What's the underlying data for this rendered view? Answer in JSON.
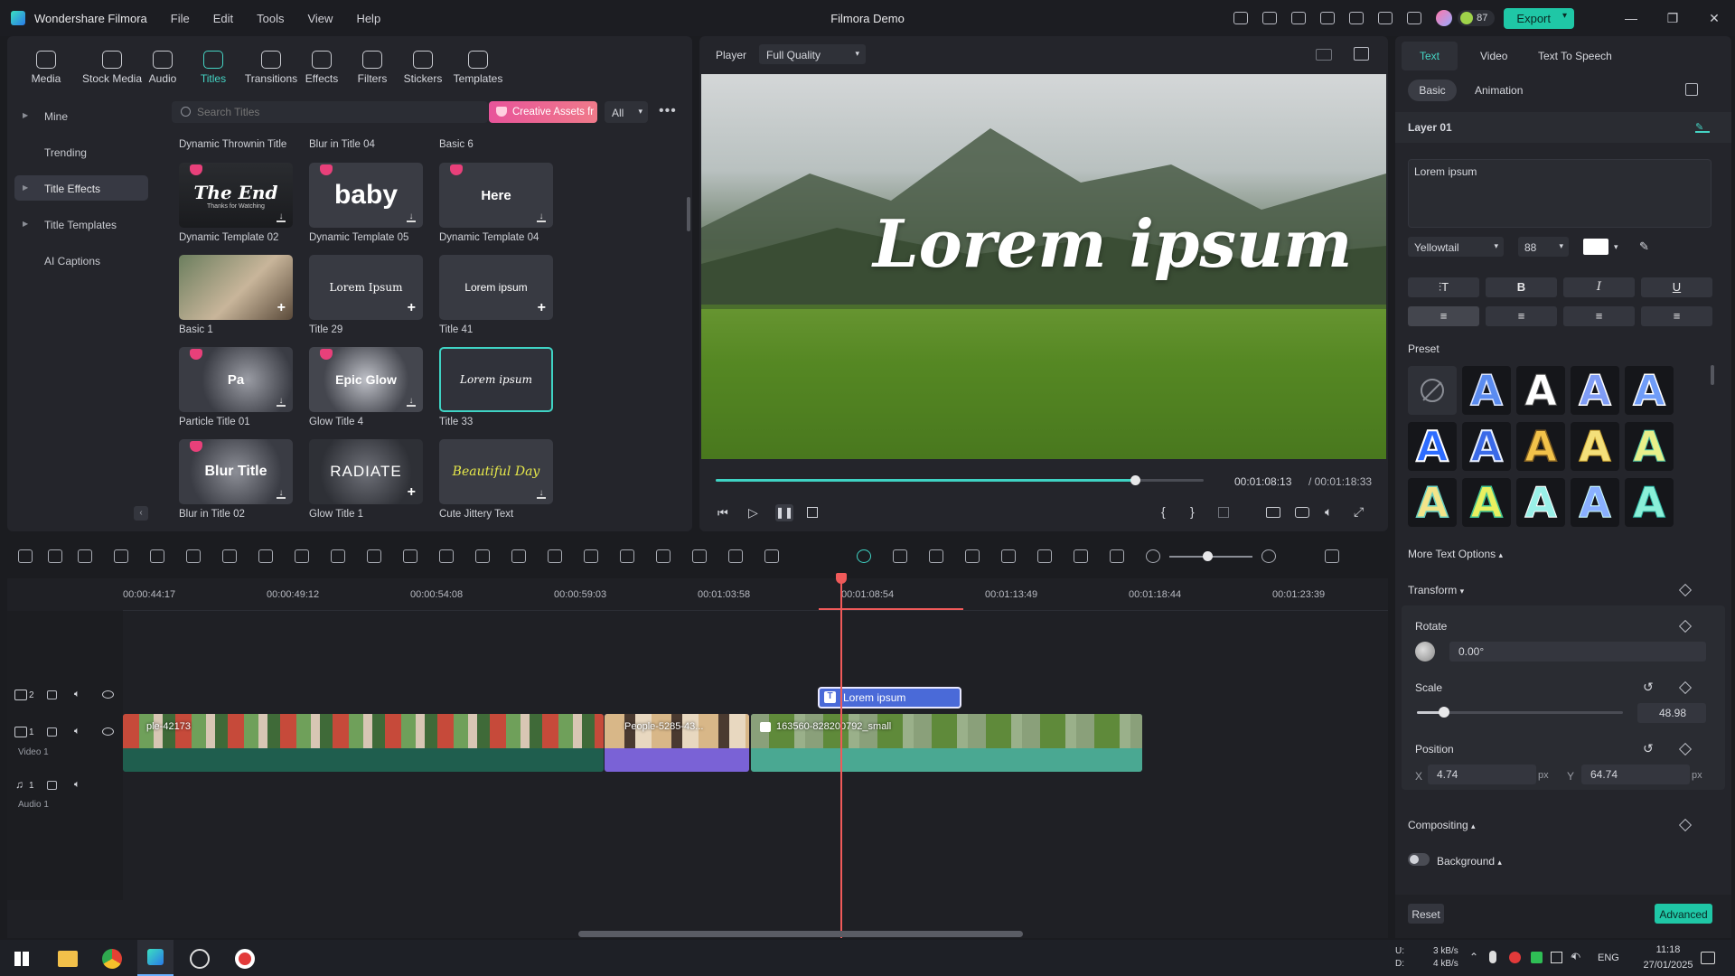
{
  "app": {
    "name": "Wondershare Filmora",
    "title": "Filmora Demo",
    "menus": [
      "File",
      "Edit",
      "Tools",
      "View",
      "Help"
    ],
    "credits": "87",
    "export_label": "Export"
  },
  "media_tabs": [
    "Media",
    "Stock Media",
    "Audio",
    "Titles",
    "Transitions",
    "Effects",
    "Filters",
    "Stickers",
    "Templates"
  ],
  "sidebar": [
    "Mine",
    "Trending",
    "Title Effects",
    "Title Templates",
    "AI Captions"
  ],
  "search": {
    "placeholder": "Search Titles",
    "creative_assets": "Creative Assets fr",
    "filter": "All"
  },
  "titles": {
    "top_row": [
      "Dynamic Thrownin Title",
      "Blur in Title 04",
      "Basic 6"
    ],
    "cards": [
      {
        "label": "Dynamic Template 02",
        "preview": "The End",
        "sub": "Thanks for Watching"
      },
      {
        "label": "Dynamic Template 05",
        "preview": "baby"
      },
      {
        "label": "Dynamic Template 04",
        "preview": "Here"
      },
      {
        "label": "Basic 1",
        "preview": ""
      },
      {
        "label": "Title 29",
        "preview": "Lorem Ipsum"
      },
      {
        "label": "Title 41",
        "preview": "Lorem ipsum"
      },
      {
        "label": "Particle Title 01",
        "preview": "Pa"
      },
      {
        "label": "Glow Title 4",
        "preview": "Epic Glow"
      },
      {
        "label": "Title 33",
        "preview": "Lorem ipsum"
      },
      {
        "label": "Blur in Title 02",
        "preview": "Blur Title"
      },
      {
        "label": "Glow Title 1",
        "preview": "RADIATE"
      },
      {
        "label": "Cute Jittery Text",
        "preview": "Beautiful Day"
      }
    ]
  },
  "player": {
    "label": "Player",
    "quality": "Full Quality",
    "overlay_text": "Lorem ipsum",
    "current_time": "00:01:08:13",
    "total_time": "/ 00:01:18:33",
    "progress": 0.86
  },
  "timeline": {
    "ruler": [
      "00:00:44:17",
      "00:00:49:12",
      "00:00:54:08",
      "00:00:59:03",
      "00:01:03:58",
      "00:01:08:54",
      "00:01:13:49",
      "00:01:18:44",
      "00:01:23:39"
    ],
    "tracks": {
      "t2": "2",
      "t1": "1",
      "video_label": "Video 1",
      "a1": "1",
      "audio_label": "Audio 1"
    },
    "title_clip": "Lorem ipsum",
    "clip1": "ple-42173",
    "clip2": "People-5285-43...",
    "clip3": "163560-828200792_small"
  },
  "props": {
    "tabs": [
      "Text",
      "Video",
      "Text To Speech"
    ],
    "subtabs": [
      "Basic",
      "Animation"
    ],
    "layer": "Layer 01",
    "text_value": "Lorem ipsum",
    "font": "Yellowtail",
    "size": "88",
    "preset_label": "Preset",
    "more_options": "More Text Options",
    "transform": "Transform",
    "rotate_label": "Rotate",
    "rotate_value": "0.00°",
    "scale_label": "Scale",
    "scale_value": "48.98",
    "scale_fraction": 0.13,
    "position_label": "Position",
    "pos_x_label": "X",
    "pos_x": "4.74",
    "pos_y_label": "Y",
    "pos_y": "64.74",
    "unit": "px",
    "compositing": "Compositing",
    "background": "Background",
    "reset": "Reset",
    "advanced": "Advanced"
  },
  "taskbar": {
    "net_up": "3 kB/s",
    "net_down": "4 kB/s",
    "lang": "ENG",
    "time": "11:18",
    "date": "27/01/2025",
    "u_label": "U:",
    "d_label": "D:"
  }
}
